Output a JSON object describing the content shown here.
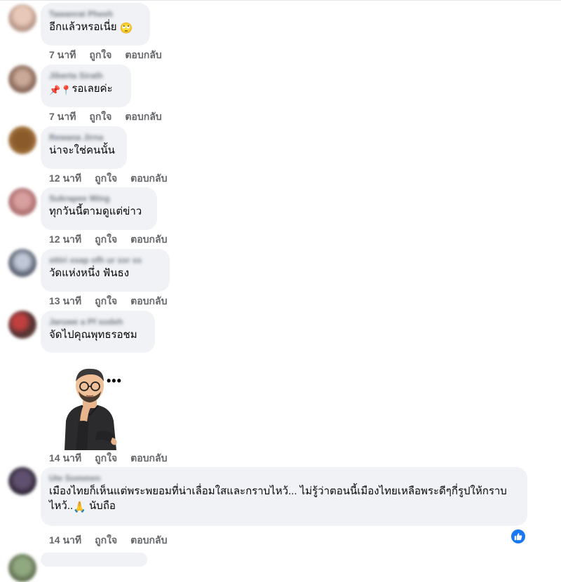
{
  "comments": [
    {
      "name": "Tawanrat Pheeh",
      "text": "อีกแล้วหรอเนี่ย",
      "emoji": "🙄",
      "time": "7 นาที",
      "like": "ถูกใจ",
      "reply": "ตอบกลับ"
    },
    {
      "name": "Jiberta Sirath",
      "prefix_emoji": "📌📍",
      "text": "รอเลยค่ะ",
      "time": "7 นาที",
      "like": "ถูกใจ",
      "reply": "ตอบกลับ"
    },
    {
      "name": "Rewana Jirna",
      "text": "น่าจะใช่คนนั้น",
      "time": "12 นาที",
      "like": "ถูกใจ",
      "reply": "ตอบกลับ"
    },
    {
      "name": "Sukrapee Wing",
      "text": "ทุกวันนี้ตามดูแต่ข่าว",
      "time": "12 นาที",
      "like": "ถูกใจ",
      "reply": "ตอบกลับ"
    },
    {
      "name": "sttiri ssap ofh ur ssr ss",
      "text": "วัดแห่งหนึ่ง ฟันธง",
      "time": "13 นาที",
      "like": "ถูกใจ",
      "reply": "ตอบกลับ"
    },
    {
      "name": "Jaruwe a Pf sodeh",
      "text": "จัดไปคุณพุทธรอชม",
      "time": "14 นาที",
      "like": "ถูกใจ",
      "reply": "ตอบกลับ",
      "more": "•••"
    },
    {
      "name": "Ute Sommen",
      "text": "เมืองไทยก็เห็นแต่พระพยอมที่น่าเลื่อมใสและกราบไหว้... ไม่รู้ว่าตอนนี้เมืองไทยเหลือพระดีๆกี่รูปให้กราบไหว้..",
      "emoji": "🙏",
      "suffix": " นับถือ",
      "time": "14 นาที",
      "like": "ถูกใจ",
      "reply": "ตอบกลับ"
    }
  ],
  "colors": {
    "bubble": "#f0f2f5",
    "meta": "#65676b",
    "like_badge": "#1877f2"
  },
  "icons": {
    "like_badge": "thumbs-up-icon",
    "more": "more-dots-icon"
  }
}
